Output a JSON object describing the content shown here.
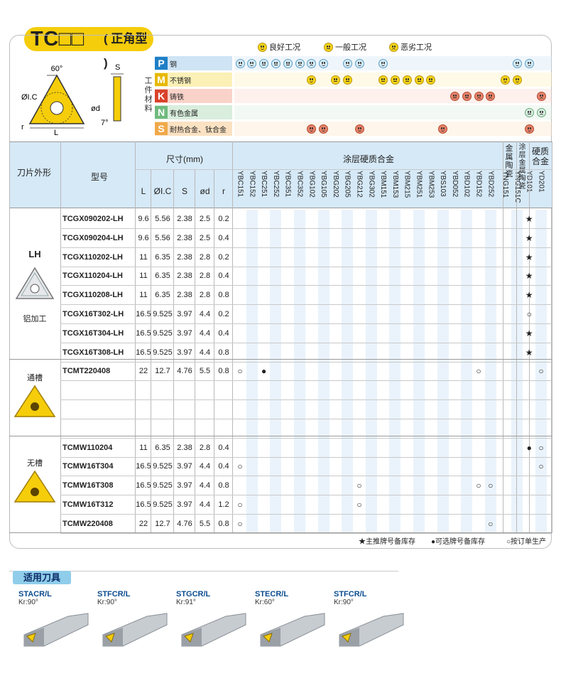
{
  "title": {
    "main": "TC□□",
    "sub": "( 正角型 )"
  },
  "legend": [
    {
      "label": "良好工况",
      "face": "good"
    },
    {
      "label": "一般工况",
      "face": "normal"
    },
    {
      "label": "恶劣工况",
      "face": "bad"
    }
  ],
  "diagram": {
    "angle": "60°",
    "s": "S",
    "ic": "ØI.C",
    "d": "ød",
    "r": "r",
    "L": "L",
    "relief": "7°"
  },
  "workpiece_label": "工件材料",
  "materials": [
    {
      "letter": "P",
      "name": "钢",
      "color": "#1f7fc6",
      "bg": "#cfe4f4"
    },
    {
      "letter": "M",
      "name": "不锈钢",
      "color": "#e7b800",
      "bg": "#fbf0b6"
    },
    {
      "letter": "K",
      "name": "铸铁",
      "color": "#d9432b",
      "bg": "#f9d3c9"
    },
    {
      "letter": "N",
      "name": "有色金属",
      "color": "#6fba7e",
      "bg": "#d9eedd"
    },
    {
      "letter": "S",
      "name": "耐热合金、钛合金",
      "color": "#f0a94a",
      "bg": "#fbe2c2"
    }
  ],
  "header": {
    "shape": "刀片外形",
    "model": "型号",
    "size": "尺寸(mm)",
    "size_cols": [
      "L",
      "ØI.C",
      "S",
      "ød",
      "r"
    ],
    "coated": "涂层硬质合金",
    "cermet": "金属陶瓷",
    "coated_cermet": "涂层金属陶瓷",
    "carbide": "硬质合金"
  },
  "grades": [
    "YBC151",
    "YBC152",
    "YBC251",
    "YBC252",
    "YBC351",
    "YBC352",
    "YBG102",
    "YBG105",
    "YBG202",
    "YBG205",
    "YBG212",
    "YBG302",
    "YBM151",
    "YBM153",
    "YBM215",
    "YBM251",
    "YBM253",
    "YBS103",
    "YBD052",
    "YBD102",
    "YBD152",
    "YBD252",
    "YNG151",
    "YNG151C",
    "YD101",
    "YD201"
  ],
  "groups": [
    {
      "name": "LH",
      "desc": "铝加工"
    },
    {
      "name": "",
      "desc": "通槽"
    },
    {
      "name": "",
      "desc": "无槽"
    }
  ],
  "rows": [
    {
      "model": "TCGX090202-LH",
      "L": "9.6",
      "ic": "5.56",
      "S": "2.38",
      "d": "2.5",
      "r": "0.2",
      "marks": {
        "24": "★"
      }
    },
    {
      "model": "TCGX090204-LH",
      "L": "9.6",
      "ic": "5.56",
      "S": "2.38",
      "d": "2.5",
      "r": "0.4",
      "marks": {
        "24": "★"
      }
    },
    {
      "model": "TCGX110202-LH",
      "L": "11",
      "ic": "6.35",
      "S": "2.38",
      "d": "2.8",
      "r": "0.2",
      "marks": {
        "24": "★"
      }
    },
    {
      "model": "TCGX110204-LH",
      "L": "11",
      "ic": "6.35",
      "S": "2.38",
      "d": "2.8",
      "r": "0.4",
      "marks": {
        "24": "★"
      }
    },
    {
      "model": "TCGX110208-LH",
      "L": "11",
      "ic": "6.35",
      "S": "2.38",
      "d": "2.8",
      "r": "0.8",
      "marks": {
        "24": "★"
      }
    },
    {
      "model": "TCGX16T302-LH",
      "L": "16.5",
      "ic": "9.525",
      "S": "3.97",
      "d": "4.4",
      "r": "0.2",
      "marks": {
        "24": "○"
      }
    },
    {
      "model": "TCGX16T304-LH",
      "L": "16.5",
      "ic": "9.525",
      "S": "3.97",
      "d": "4.4",
      "r": "0.4",
      "marks": {
        "24": "★"
      }
    },
    {
      "model": "TCGX16T308-LH",
      "L": "16.5",
      "ic": "9.525",
      "S": "3.97",
      "d": "4.4",
      "r": "0.8",
      "marks": {
        "24": "★"
      }
    },
    {
      "model": "TCMT220408",
      "L": "22",
      "ic": "12.7",
      "S": "4.76",
      "d": "5.5",
      "r": "0.8",
      "marks": {
        "0": "○",
        "2": "●",
        "20": "○",
        "25": "○"
      }
    },
    {
      "model": "",
      "L": "",
      "ic": "",
      "S": "",
      "d": "",
      "r": "",
      "marks": {}
    },
    {
      "model": "",
      "L": "",
      "ic": "",
      "S": "",
      "d": "",
      "r": "",
      "marks": {}
    },
    {
      "model": "",
      "L": "",
      "ic": "",
      "S": "",
      "d": "",
      "r": "",
      "marks": {}
    },
    {
      "model": "TCMW110204",
      "L": "11",
      "ic": "6.35",
      "S": "2.38",
      "d": "2.8",
      "r": "0.4",
      "marks": {
        "24": "●",
        "25": "○"
      }
    },
    {
      "model": "TCMW16T304",
      "L": "16.5",
      "ic": "9.525",
      "S": "3.97",
      "d": "4.4",
      "r": "0.4",
      "marks": {
        "0": "○",
        "25": "○"
      }
    },
    {
      "model": "TCMW16T308",
      "L": "16.5",
      "ic": "9.525",
      "S": "3.97",
      "d": "4.4",
      "r": "0.8",
      "marks": {
        "10": "○",
        "20": "○",
        "21": "○"
      }
    },
    {
      "model": "TCMW16T312",
      "L": "16.5",
      "ic": "9.525",
      "S": "3.97",
      "d": "4.4",
      "r": "1.2",
      "marks": {
        "0": "○",
        "10": "○"
      }
    },
    {
      "model": "TCMW220408",
      "L": "22",
      "ic": "12.7",
      "S": "4.76",
      "d": "5.5",
      "r": "0.8",
      "marks": {
        "0": "○",
        "21": "○"
      }
    }
  ],
  "notes": [
    "★主推牌号备库存",
    "●可选牌号备库存",
    "○按订单生产"
  ],
  "tools_title": "适用刀具",
  "tools": [
    {
      "name": "STACR/L",
      "kr": "Kr:90°"
    },
    {
      "name": "STFCR/L",
      "kr": "Kr:90°"
    },
    {
      "name": "STGCR/L",
      "kr": "Kr:91°"
    },
    {
      "name": "STECR/L",
      "kr": "Kr:60°"
    },
    {
      "name": "STFCR/L",
      "kr": "Kr:90°"
    }
  ]
}
